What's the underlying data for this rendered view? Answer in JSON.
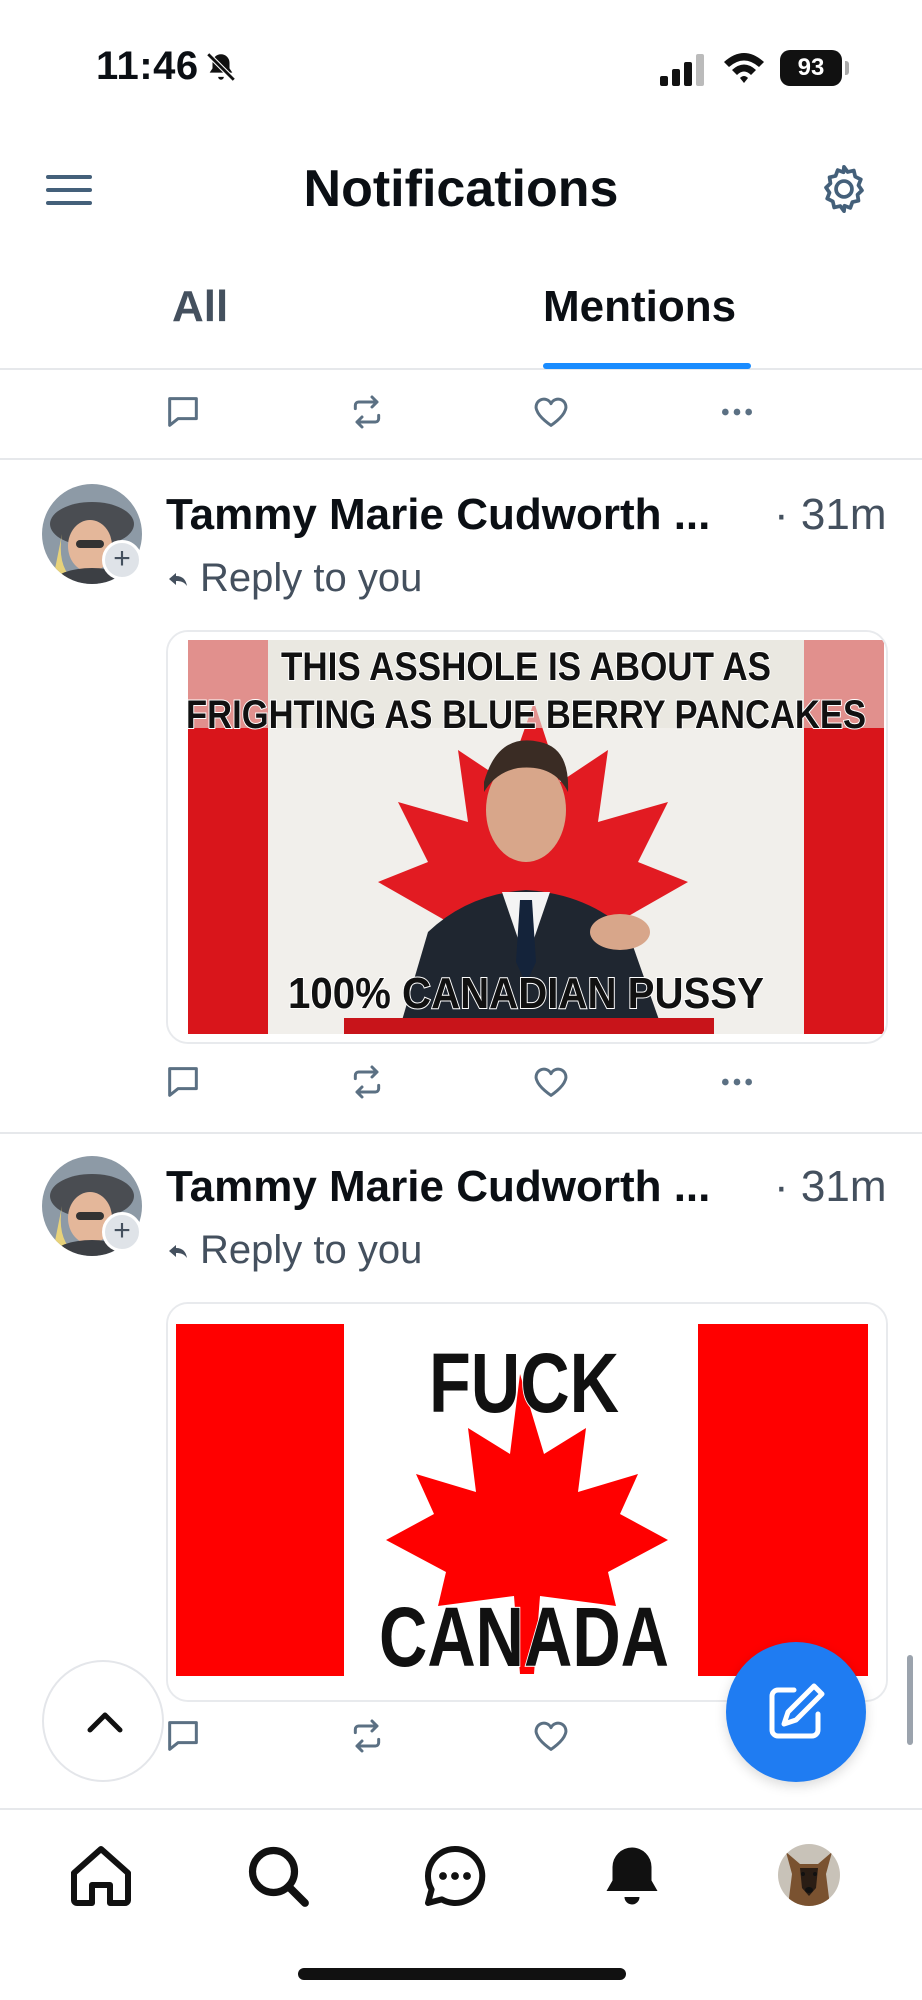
{
  "status_bar": {
    "time": "11:46",
    "battery": "93"
  },
  "header": {
    "title": "Notifications",
    "menu_icon": "hamburger-menu-icon",
    "settings_icon": "gear-icon"
  },
  "tabs": [
    {
      "label": "All",
      "selected": false
    },
    {
      "label": "Mentions",
      "selected": true
    }
  ],
  "notifications": [
    {
      "author": "Tammy Marie Cudworth ...",
      "time": "· 31m",
      "context": "Reply to you",
      "image_text": {
        "top_line_1": "THIS ASSHOLE IS ABOUT AS",
        "top_line_2": "FRIGHTING AS BLUE BERRY PANCAKES",
        "bottom": "100% CANADIAN PUSSY"
      }
    },
    {
      "author": "Tammy Marie Cudworth ...",
      "time": "· 31m",
      "context": "Reply to you",
      "image_text": {
        "top": "FUCK",
        "bottom": "CANADA"
      }
    }
  ],
  "bottom_nav": [
    {
      "icon": "home-icon"
    },
    {
      "icon": "search-icon"
    },
    {
      "icon": "chat-icon"
    },
    {
      "icon": "bell-icon",
      "active": true
    },
    {
      "icon": "profile-avatar"
    }
  ],
  "colors": {
    "accent": "#1a8cff",
    "compose": "#1f7cf2",
    "flag_red": "#ff0000",
    "icon_gray": "#5b7083"
  }
}
